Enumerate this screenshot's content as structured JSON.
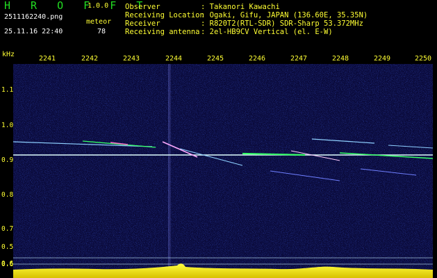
{
  "header": {
    "app_name": "H R O F F T",
    "version": "1.0.0",
    "filename": "2511162240.png",
    "timestamp": "25.11.16 22:40",
    "meteor_label": "meteor",
    "meteor_count": "78"
  },
  "info": [
    {
      "key": "Observer",
      "value": ": Takanori Kawachi"
    },
    {
      "key": "Receiving Location",
      "value": ": Ogaki, Gifu, JAPAN (136.60E, 35.35N)"
    },
    {
      "key": "Receiver",
      "value": ": R820T2(RTL-SDR) SDR-Sharp 53.372MHz"
    },
    {
      "key": "Receiving antenna",
      "value": ": 2el-HB9CV Vertical (el. E-W)"
    }
  ],
  "axes": {
    "y_unit": "kHz",
    "time_ticks": [
      "2241",
      "2242",
      "2243",
      "2244",
      "2245",
      "2246",
      "2247",
      "2248",
      "2249",
      "2250"
    ],
    "freq_ticks": [
      "1.1",
      "1.0",
      "0.9",
      "0.8",
      "0.7",
      "0.6",
      "0.5",
      "0.6"
    ]
  },
  "colors": {
    "header_green": "#22dd22",
    "label_yellow": "#ffff33",
    "background": "#0a0a3a",
    "carrier": "#e0ffff"
  }
}
